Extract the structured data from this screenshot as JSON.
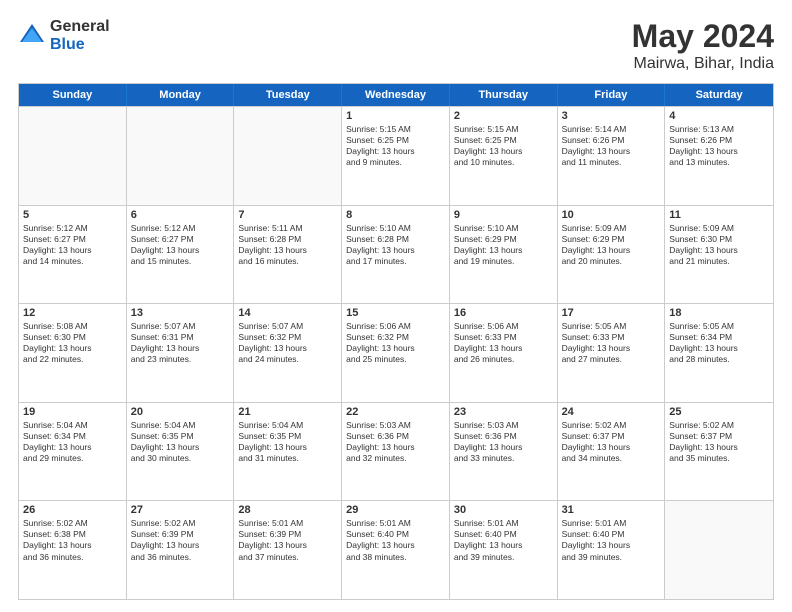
{
  "logo": {
    "general": "General",
    "blue": "Blue"
  },
  "title": "May 2024",
  "subtitle": "Mairwa, Bihar, India",
  "days_of_week": [
    "Sunday",
    "Monday",
    "Tuesday",
    "Wednesday",
    "Thursday",
    "Friday",
    "Saturday"
  ],
  "weeks": [
    [
      {
        "day": "",
        "empty": true,
        "lines": []
      },
      {
        "day": "",
        "empty": true,
        "lines": []
      },
      {
        "day": "",
        "empty": true,
        "lines": []
      },
      {
        "day": "1",
        "lines": [
          "Sunrise: 5:15 AM",
          "Sunset: 6:25 PM",
          "Daylight: 13 hours",
          "and 9 minutes."
        ]
      },
      {
        "day": "2",
        "lines": [
          "Sunrise: 5:15 AM",
          "Sunset: 6:25 PM",
          "Daylight: 13 hours",
          "and 10 minutes."
        ]
      },
      {
        "day": "3",
        "lines": [
          "Sunrise: 5:14 AM",
          "Sunset: 6:26 PM",
          "Daylight: 13 hours",
          "and 11 minutes."
        ]
      },
      {
        "day": "4",
        "lines": [
          "Sunrise: 5:13 AM",
          "Sunset: 6:26 PM",
          "Daylight: 13 hours",
          "and 13 minutes."
        ]
      }
    ],
    [
      {
        "day": "5",
        "lines": [
          "Sunrise: 5:12 AM",
          "Sunset: 6:27 PM",
          "Daylight: 13 hours",
          "and 14 minutes."
        ]
      },
      {
        "day": "6",
        "lines": [
          "Sunrise: 5:12 AM",
          "Sunset: 6:27 PM",
          "Daylight: 13 hours",
          "and 15 minutes."
        ]
      },
      {
        "day": "7",
        "lines": [
          "Sunrise: 5:11 AM",
          "Sunset: 6:28 PM",
          "Daylight: 13 hours",
          "and 16 minutes."
        ]
      },
      {
        "day": "8",
        "lines": [
          "Sunrise: 5:10 AM",
          "Sunset: 6:28 PM",
          "Daylight: 13 hours",
          "and 17 minutes."
        ]
      },
      {
        "day": "9",
        "lines": [
          "Sunrise: 5:10 AM",
          "Sunset: 6:29 PM",
          "Daylight: 13 hours",
          "and 19 minutes."
        ]
      },
      {
        "day": "10",
        "lines": [
          "Sunrise: 5:09 AM",
          "Sunset: 6:29 PM",
          "Daylight: 13 hours",
          "and 20 minutes."
        ]
      },
      {
        "day": "11",
        "lines": [
          "Sunrise: 5:09 AM",
          "Sunset: 6:30 PM",
          "Daylight: 13 hours",
          "and 21 minutes."
        ]
      }
    ],
    [
      {
        "day": "12",
        "lines": [
          "Sunrise: 5:08 AM",
          "Sunset: 6:30 PM",
          "Daylight: 13 hours",
          "and 22 minutes."
        ]
      },
      {
        "day": "13",
        "lines": [
          "Sunrise: 5:07 AM",
          "Sunset: 6:31 PM",
          "Daylight: 13 hours",
          "and 23 minutes."
        ]
      },
      {
        "day": "14",
        "lines": [
          "Sunrise: 5:07 AM",
          "Sunset: 6:32 PM",
          "Daylight: 13 hours",
          "and 24 minutes."
        ]
      },
      {
        "day": "15",
        "lines": [
          "Sunrise: 5:06 AM",
          "Sunset: 6:32 PM",
          "Daylight: 13 hours",
          "and 25 minutes."
        ]
      },
      {
        "day": "16",
        "lines": [
          "Sunrise: 5:06 AM",
          "Sunset: 6:33 PM",
          "Daylight: 13 hours",
          "and 26 minutes."
        ]
      },
      {
        "day": "17",
        "lines": [
          "Sunrise: 5:05 AM",
          "Sunset: 6:33 PM",
          "Daylight: 13 hours",
          "and 27 minutes."
        ]
      },
      {
        "day": "18",
        "lines": [
          "Sunrise: 5:05 AM",
          "Sunset: 6:34 PM",
          "Daylight: 13 hours",
          "and 28 minutes."
        ]
      }
    ],
    [
      {
        "day": "19",
        "lines": [
          "Sunrise: 5:04 AM",
          "Sunset: 6:34 PM",
          "Daylight: 13 hours",
          "and 29 minutes."
        ]
      },
      {
        "day": "20",
        "lines": [
          "Sunrise: 5:04 AM",
          "Sunset: 6:35 PM",
          "Daylight: 13 hours",
          "and 30 minutes."
        ]
      },
      {
        "day": "21",
        "lines": [
          "Sunrise: 5:04 AM",
          "Sunset: 6:35 PM",
          "Daylight: 13 hours",
          "and 31 minutes."
        ]
      },
      {
        "day": "22",
        "lines": [
          "Sunrise: 5:03 AM",
          "Sunset: 6:36 PM",
          "Daylight: 13 hours",
          "and 32 minutes."
        ]
      },
      {
        "day": "23",
        "lines": [
          "Sunrise: 5:03 AM",
          "Sunset: 6:36 PM",
          "Daylight: 13 hours",
          "and 33 minutes."
        ]
      },
      {
        "day": "24",
        "lines": [
          "Sunrise: 5:02 AM",
          "Sunset: 6:37 PM",
          "Daylight: 13 hours",
          "and 34 minutes."
        ]
      },
      {
        "day": "25",
        "lines": [
          "Sunrise: 5:02 AM",
          "Sunset: 6:37 PM",
          "Daylight: 13 hours",
          "and 35 minutes."
        ]
      }
    ],
    [
      {
        "day": "26",
        "lines": [
          "Sunrise: 5:02 AM",
          "Sunset: 6:38 PM",
          "Daylight: 13 hours",
          "and 36 minutes."
        ]
      },
      {
        "day": "27",
        "lines": [
          "Sunrise: 5:02 AM",
          "Sunset: 6:39 PM",
          "Daylight: 13 hours",
          "and 36 minutes."
        ]
      },
      {
        "day": "28",
        "lines": [
          "Sunrise: 5:01 AM",
          "Sunset: 6:39 PM",
          "Daylight: 13 hours",
          "and 37 minutes."
        ]
      },
      {
        "day": "29",
        "lines": [
          "Sunrise: 5:01 AM",
          "Sunset: 6:40 PM",
          "Daylight: 13 hours",
          "and 38 minutes."
        ]
      },
      {
        "day": "30",
        "lines": [
          "Sunrise: 5:01 AM",
          "Sunset: 6:40 PM",
          "Daylight: 13 hours",
          "and 39 minutes."
        ]
      },
      {
        "day": "31",
        "lines": [
          "Sunrise: 5:01 AM",
          "Sunset: 6:40 PM",
          "Daylight: 13 hours",
          "and 39 minutes."
        ]
      },
      {
        "day": "",
        "empty": true,
        "lines": []
      }
    ]
  ]
}
